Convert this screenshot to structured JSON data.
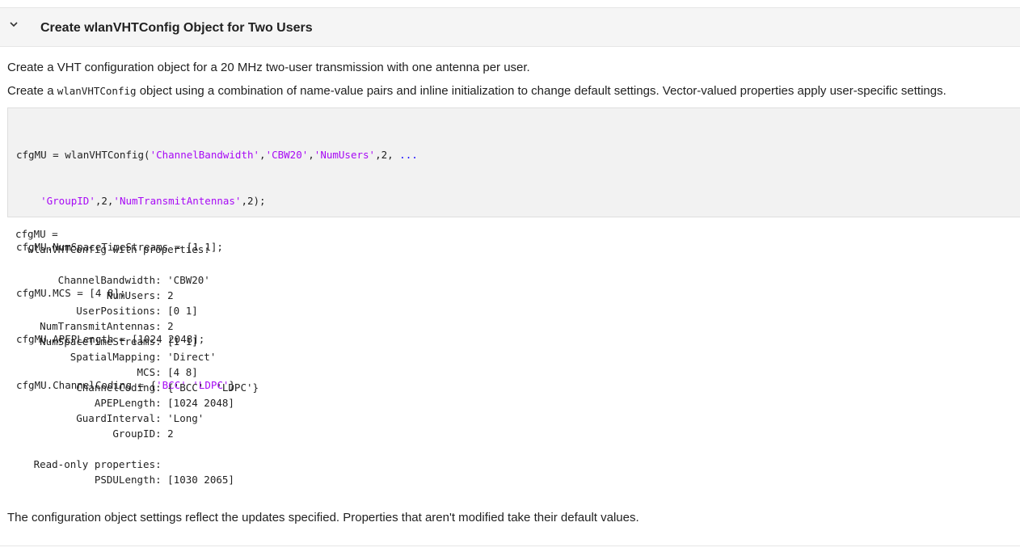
{
  "section": {
    "title": "Create wlanVHTConfig Object for Two Users",
    "chevron_icon": "chevron-down-icon"
  },
  "intro": {
    "para1": "Create a VHT configuration object for a 20 MHz two-user transmission with one antenna per user.",
    "para2_before": "Create a ",
    "para2_code": "wlanVHTConfig",
    "para2_after": " object using a combination of name-value pairs and inline initialization to change default settings. Vector-valued properties apply user-specific settings."
  },
  "code": {
    "line1": [
      {
        "t": "cfgMU = wlanVHTConfig(",
        "k": "plain"
      },
      {
        "t": "'ChannelBandwidth'",
        "k": "str"
      },
      {
        "t": ",",
        "k": "plain"
      },
      {
        "t": "'CBW20'",
        "k": "str"
      },
      {
        "t": ",",
        "k": "plain"
      },
      {
        "t": "'NumUsers'",
        "k": "str"
      },
      {
        "t": ",2, ",
        "k": "plain"
      },
      {
        "t": "...",
        "k": "ellipsis"
      }
    ],
    "line2": [
      {
        "t": "    ",
        "k": "plain"
      },
      {
        "t": "'GroupID'",
        "k": "str"
      },
      {
        "t": ",2,",
        "k": "plain"
      },
      {
        "t": "'NumTransmitAntennas'",
        "k": "str"
      },
      {
        "t": ",2);",
        "k": "plain"
      }
    ],
    "line3": [
      {
        "t": "cfgMU.NumSpaceTimeStreams = [1 1];",
        "k": "plain"
      }
    ],
    "line4": [
      {
        "t": "cfgMU.MCS = [4 8];",
        "k": "plain"
      }
    ],
    "line5": [
      {
        "t": "cfgMU.APEPLength = [1024 2048];",
        "k": "plain"
      }
    ],
    "line6": [
      {
        "t": "cfgMU.ChannelCoding = {",
        "k": "plain"
      },
      {
        "t": "'BCC'",
        "k": "str"
      },
      {
        "t": " ",
        "k": "plain"
      },
      {
        "t": "'LDPC'",
        "k": "str"
      },
      {
        "t": "}",
        "k": "plain"
      }
    ]
  },
  "output": {
    "lines": [
      "cfgMU = ",
      "  wlanVHTConfig with properties:",
      "",
      "       ChannelBandwidth: 'CBW20'",
      "               NumUsers: 2",
      "          UserPositions: [0 1]",
      "    NumTransmitAntennas: 2",
      "    NumSpaceTimeStreams: [1 1]",
      "         SpatialMapping: 'Direct'",
      "                    MCS: [4 8]",
      "          ChannelCoding: {'BCC'  'LDPC'}",
      "             APEPLength: [1024 2048]",
      "          GuardInterval: 'Long'",
      "                GroupID: 2",
      "",
      "   Read-only properties:",
      "             PSDULength: [1030 2065]"
    ]
  },
  "conclusion": {
    "text": "The configuration object settings reflect the updates specified. Properties that aren't modified take their default values."
  },
  "colors": {
    "string": "#a709f5",
    "ellipsis": "#0e00ff",
    "header_bg": "#f5f5f5",
    "code_bg": "#f2f2f2"
  }
}
